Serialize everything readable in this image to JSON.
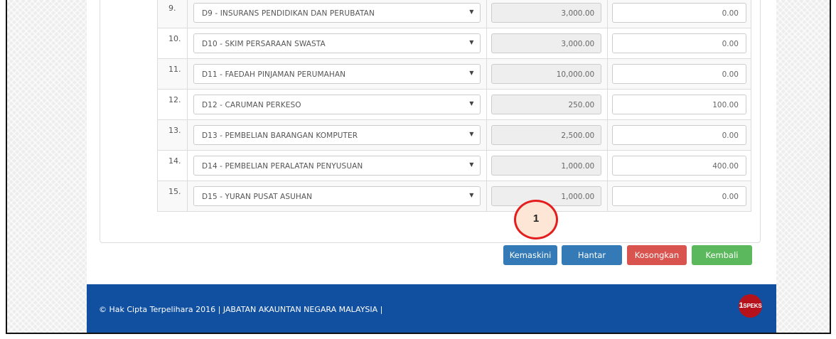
{
  "deductions": [
    {
      "no": "9.",
      "item": "D9 - INSURANS PENDIDIKAN DAN PERUBATAN",
      "limit": "3,000.00",
      "claim": "0.00"
    },
    {
      "no": "10.",
      "item": "D10 - SKIM PERSARAAN SWASTA",
      "limit": "3,000.00",
      "claim": "0.00"
    },
    {
      "no": "11.",
      "item": "D11 - FAEDAH PINJAMAN PERUMAHAN",
      "limit": "10,000.00",
      "claim": "0.00"
    },
    {
      "no": "12.",
      "item": "D12 - CARUMAN PERKESO",
      "limit": "250.00",
      "claim": "100.00"
    },
    {
      "no": "13.",
      "item": "D13 - PEMBELIAN BARANGAN KOMPUTER",
      "limit": "2,500.00",
      "claim": "0.00"
    },
    {
      "no": "14.",
      "item": "D14 - PEMBELIAN PERALATAN PENYUSUAN",
      "limit": "1,000.00",
      "claim": "400.00"
    },
    {
      "no": "15.",
      "item": "D15 - YURAN PUSAT ASUHAN",
      "limit": "1,000.00",
      "claim": "0.00"
    }
  ],
  "dropdown_icon": "caret-down-icon",
  "annotation": {
    "label": "1"
  },
  "actions": {
    "update_label": "Kemaskini",
    "send_label": "Hantar",
    "clear_label": "Kosongkan",
    "back_label": "Kembali"
  },
  "footer": {
    "copyright": "© Hak Cipta Terpelihara 2016 | JABATAN AKAUNTAN NEGARA MALAYSIA |",
    "logo_text": "1SPEKS"
  },
  "colors": {
    "primary": "#337ab7",
    "danger": "#d9534f",
    "success": "#5cb85c",
    "footer": "#1150a0",
    "marker": "#e41e1e"
  }
}
